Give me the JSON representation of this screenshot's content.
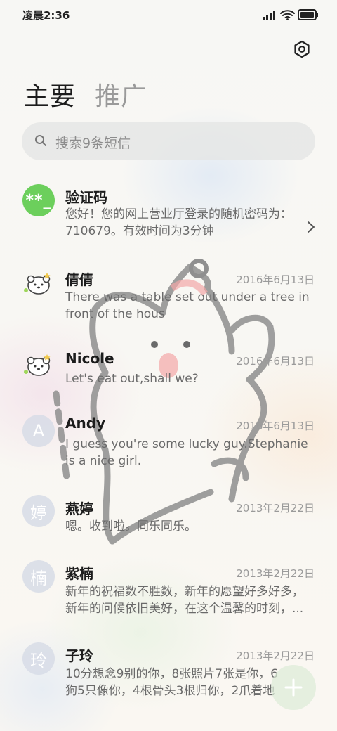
{
  "status": {
    "time": "凌晨2:36"
  },
  "tabs": [
    {
      "label": "主要"
    },
    {
      "label": "推广"
    }
  ],
  "search": {
    "placeholder": "搜索9条短信"
  },
  "icons": {
    "settings": "hexagon-gear-icon",
    "search": "search-icon",
    "chevron": "chevron-right-icon",
    "fab": "plus-icon",
    "signal": "signal-icon",
    "wifi": "wifi-icon",
    "battery": "battery-icon"
  },
  "colors": {
    "code_avatar": "#6ccf5c",
    "letter_avatar": "#d7dce6"
  },
  "messages": [
    {
      "avatar": "**_",
      "name": "验证码",
      "date": "",
      "line1": "您好！您的网上营业厅登录的随机密码为：",
      "line2": "710679。有效时间为3分钟"
    },
    {
      "avatar": "",
      "name": "倩倩",
      "date": "2016年6月13日",
      "line1": "There was a table set out under a tree in",
      "line2": "front of the hous"
    },
    {
      "avatar": "",
      "name": "Nicole",
      "date": "2016年6月13日",
      "line1": "Let's eat out,shall we?",
      "line2": ""
    },
    {
      "avatar": "A",
      "name": "Andy",
      "date": "2016年6月13日",
      "line1": "I guess you're some lucky guy.Stephanie",
      "line2": "is a nice girl."
    },
    {
      "avatar": "婷",
      "name": "燕婷",
      "date": "2013年2月22日",
      "line1": "嗯。收到啦。同乐同乐。",
      "line2": ""
    },
    {
      "avatar": "楠",
      "name": "紫楠",
      "date": "2013年2月22日",
      "line1": "新年的祝福数不胜数，新年的愿望好多好多，",
      "line2": "新年的问候依旧美好，在这个温馨的时刻，..."
    },
    {
      "avatar": "玲",
      "name": "子玲",
      "date": "2013年2月22日",
      "line1": "10分想念9别的你，8张照片7张是你，6",
      "line2": "狗5只像你，4根骨头3根归你，2爪着地"
    }
  ]
}
